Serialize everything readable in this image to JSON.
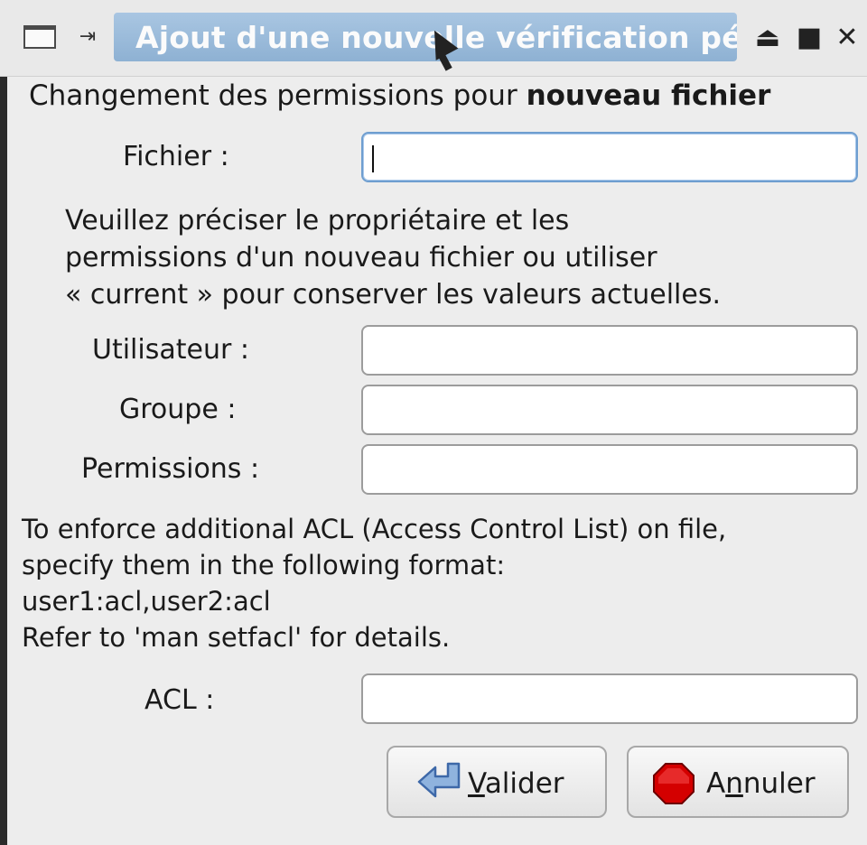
{
  "window": {
    "title": "Ajout d'une nouvelle vérification pér",
    "icons": [
      "window-menu-icon",
      "pin-icon",
      "shade-icon",
      "maximize-icon",
      "close-icon"
    ]
  },
  "heading": {
    "prefix": "Changement des permissions pour ",
    "bold": "nouveau fichier"
  },
  "fields": {
    "file_label": "Fichier :",
    "file_value": "",
    "owner_intro": [
      "Veuillez préciser le propriétaire et les",
      "permissions d'un nouveau fichier ou utiliser",
      "« current » pour conserver les valeurs actuelles."
    ],
    "user_label": "Utilisateur :",
    "user_value": "",
    "group_label": "Groupe :",
    "group_value": "",
    "perms_label": "Permissions :",
    "perms_value": "",
    "acl_help": [
      "To enforce additional ACL (Access Control List) on file,",
      "specify them in the following format:",
      "user1:acl,user2:acl",
      "Refer to 'man setfacl' for details."
    ],
    "acl_label": "ACL :",
    "acl_value": ""
  },
  "buttons": {
    "ok_before": "",
    "ok_mnemonic": "V",
    "ok_after": "alider",
    "cancel_before": "A",
    "cancel_mnemonic": "n",
    "cancel_after": "nuler"
  }
}
